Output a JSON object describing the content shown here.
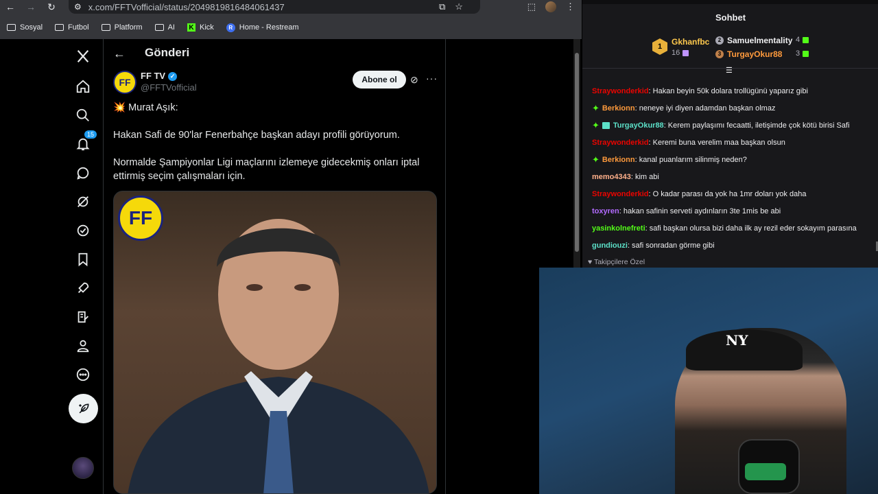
{
  "browser": {
    "url": "x.com/FFTVofficial/status/2049819816484061437",
    "bookmarks": [
      {
        "label": "Sosyal",
        "icon": "folder-icon"
      },
      {
        "label": "Futbol",
        "icon": "folder-icon"
      },
      {
        "label": "Platform",
        "icon": "folder-icon"
      },
      {
        "label": "AI",
        "icon": "folder-icon"
      },
      {
        "label": "Kick",
        "icon": "kick-icon"
      },
      {
        "label": "Home - Restream",
        "icon": "restream-icon"
      }
    ]
  },
  "x": {
    "nav_badge": "15",
    "post_title": "Gönderi",
    "author_name": "FF TV",
    "author_handle": "@FFTVofficial",
    "subscribe_label": "Abone ol",
    "post_lines": [
      "💥 Murat Aşık:",
      "Hakan Safi de 90'lar Fenerbahçe başkan adayı profili görüyorum.",
      "Normalde Şampiyonlar Ligi maçlarını izlemeye gidecekmiş onları iptal ettirmiş seçim çalışmaları için."
    ],
    "media_logo_text": "FF"
  },
  "chat": {
    "title": "Sohbet",
    "leaderboard": [
      {
        "rank": "1",
        "name": "Gkhanfbc",
        "count": "16"
      },
      {
        "rank": "2",
        "name": "Samuelmentality",
        "count": "4"
      },
      {
        "rank": "3",
        "name": "TurgayOkur88",
        "count": "3"
      }
    ],
    "messages": [
      {
        "user": "Straywonderkid",
        "color": "#eb0400",
        "badge": "",
        "text": ": Hakan beyin 50k dolara trollügünü yaparız gibi"
      },
      {
        "user": "Berkionn",
        "color": "#ff9a3c",
        "badge": "star",
        "text": ": neneye iyi diyen adamdan başkan olmaz"
      },
      {
        "user": "TurgayOkur88",
        "color": "#5ce0c8",
        "badge": "star-gift",
        "text": ": Kerem paylaşımı fecaatti, iletişimde çok kötü birisi Safi"
      },
      {
        "user": "Straywonderkid",
        "color": "#eb0400",
        "badge": "",
        "text": ": Keremi buna verelim maa başkan olsun"
      },
      {
        "user": "Berkionn",
        "color": "#ff9a3c",
        "badge": "star",
        "text": ": kanal puanlarım silinmiş neden?"
      },
      {
        "user": "memo4343",
        "color": "#ffb08a",
        "badge": "",
        "text": ": kim abi"
      },
      {
        "user": "Straywonderkid",
        "color": "#eb0400",
        "badge": "",
        "text": ": O kadar parası da yok ha 1mr doları yok daha"
      },
      {
        "user": "toxyren",
        "color": "#b26bff",
        "badge": "",
        "text": ": hakan safinin serveti aydınların 3te 1mis be abi"
      },
      {
        "user": "yasinkolnefreti",
        "color": "#53fc18",
        "badge": "",
        "text": ": safi başkan olursa bizi daha ilk ay rezil eder sokayım parasına"
      },
      {
        "user": "gundiouzi",
        "color": "#5ce0c8",
        "badge": "",
        "text": ": safi sonradan görme gibi"
      }
    ],
    "followers_only": "Takipçilere Özel"
  },
  "webcam": {
    "cap_logo": "NY"
  }
}
